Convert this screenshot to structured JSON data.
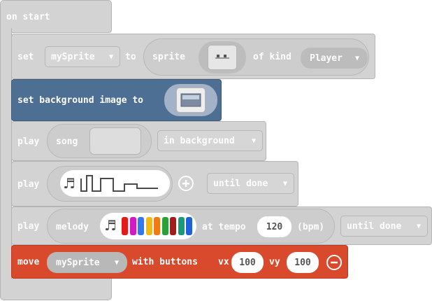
{
  "on_start": {
    "label": "on start"
  },
  "set_sprite": {
    "set": "set",
    "variable": "mySprite",
    "to": "to",
    "sprite": "sprite",
    "of_kind": "of kind",
    "kind": "Player"
  },
  "set_background": {
    "label": "set background image to"
  },
  "play_song": {
    "play": "play",
    "song": "song",
    "mode": "in background"
  },
  "play_sound": {
    "play": "play",
    "mode": "until done",
    "add_icon": "plus-circle-icon"
  },
  "play_melody": {
    "play": "play",
    "melody": "melody",
    "at_tempo": "at tempo",
    "tempo": "120",
    "bpm": "(bpm)",
    "mode": "until done",
    "note_colors": [
      "#e21b1b",
      "#d11ac4",
      "#3478f0",
      "#f2bb13",
      "#f27a13",
      "#2a9f3a",
      "#a51a1a",
      "#1b9a7a",
      "#2060d8"
    ]
  },
  "move_sprite": {
    "move": "move",
    "variable": "mySprite",
    "with_buttons": "with buttons",
    "vx_label": "vx",
    "vx": "100",
    "vy_label": "vy",
    "vy": "100",
    "color": "#d9492b",
    "remove_icon": "minus-circle-icon"
  },
  "colors": {
    "background_block": "#4e6f94",
    "move_block": "#d9492b",
    "disabled_block": "#d3d3d3"
  }
}
